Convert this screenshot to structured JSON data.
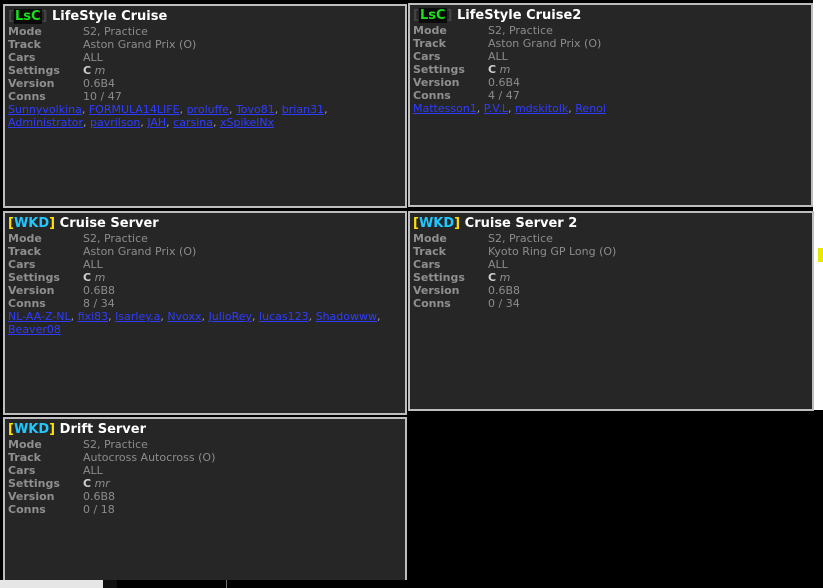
{
  "labels": {
    "mode": "Mode",
    "track": "Track",
    "cars": "Cars",
    "settings": "Settings",
    "version": "Version",
    "conns": "Conns"
  },
  "servers": [
    {
      "tag": "LsC",
      "name": "LifeStyle Cruise",
      "mode": "S2, Practice",
      "track": "Aston Grand Prix (O)",
      "cars": "ALL",
      "settings_flag": "C",
      "settings_extra": "m",
      "version": "0.6B4",
      "conns": "10 / 47",
      "players": [
        "Sunnyvolkina",
        "FORMULA14LIFE",
        "proluffe",
        "Tovo81",
        "brian31",
        "Administrator",
        "pavrilson",
        "JAH",
        "carsina",
        "xSpikelNx"
      ]
    },
    {
      "tag": "LsC",
      "name": "LifeStyle Cruise2",
      "mode": "S2, Practice",
      "track": "Aston Grand Prix (O)",
      "cars": "ALL",
      "settings_flag": "C",
      "settings_extra": "m",
      "version": "0.6B4",
      "conns": "4 / 47",
      "players": [
        "Mattesson1",
        "P.V.L",
        "mdskitolk",
        "Renoi"
      ]
    },
    {
      "tag": "WKD",
      "name": "Cruise Server",
      "mode": "S2, Practice",
      "track": "Aston Grand Prix (O)",
      "cars": "ALL",
      "settings_flag": "C",
      "settings_extra": "m",
      "version": "0.6B8",
      "conns": "8 / 34",
      "players": [
        "NL-AA-Z-NL",
        "fixi83",
        "Isarley.a",
        "Nvoxx",
        "JulioRey",
        "lucas123",
        "Shadowww",
        "Beaver08"
      ]
    },
    {
      "tag": "WKD",
      "name": "Cruise Server 2",
      "mode": "S2, Practice",
      "track": "Kyoto Ring GP Long (O)",
      "cars": "ALL",
      "settings_flag": "C",
      "settings_extra": "m",
      "version": "0.6B8",
      "conns": "0 / 34",
      "players": []
    },
    {
      "tag": "WKD",
      "name": "Drift Server",
      "mode": "S2, Practice",
      "track": "Autocross Autocross (O)",
      "cars": "ALL",
      "settings_flag": "C",
      "settings_extra": "mr",
      "version": "0.6B8",
      "conns": "0 / 18",
      "players": []
    }
  ],
  "colors": {
    "panel_bg": "#262626",
    "border": "#bdbdbd",
    "player_link": "#2f3cff",
    "lsc_tag": "#18e018",
    "wkd_tag": "#20c8ff",
    "wkd_bracket": "#ffe000"
  }
}
